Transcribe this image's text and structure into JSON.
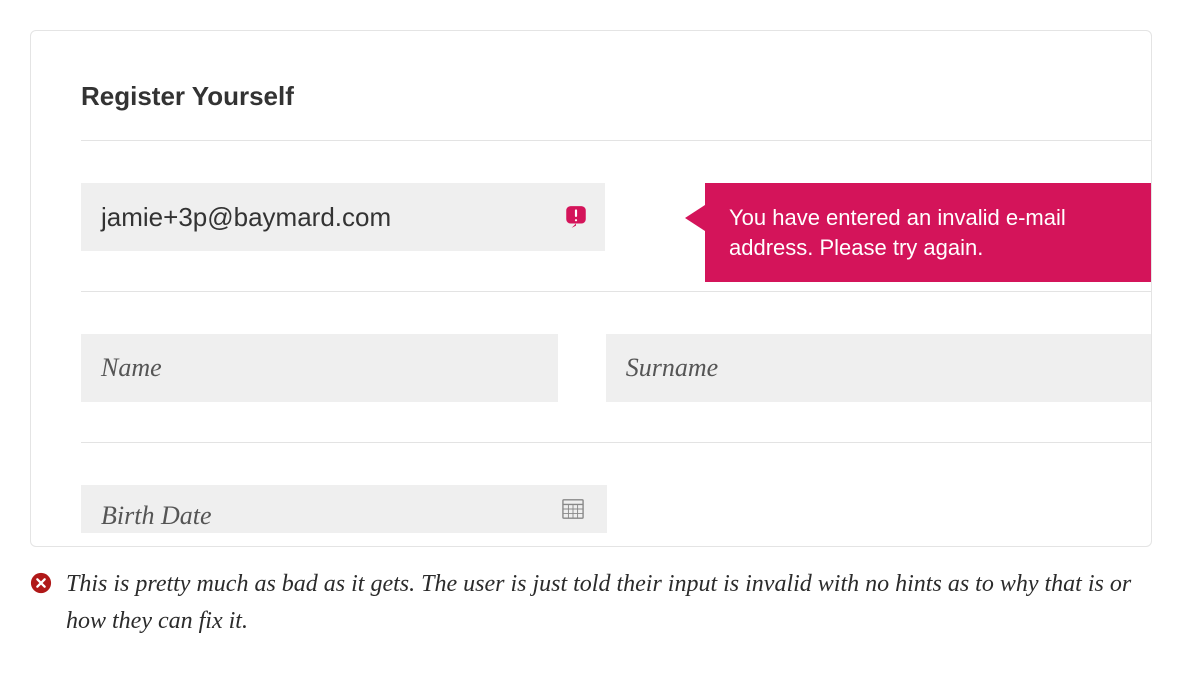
{
  "form": {
    "title": "Register Yourself",
    "email_value": "jamie+3p@baymard.com",
    "email_error": "You have entered an invalid e-mail address. Please try again.",
    "name_placeholder": "Name",
    "surname_placeholder": "Surname",
    "birth_placeholder": "Birth Date"
  },
  "caption": "This is pretty much as bad as it gets. The user is just told their input is invalid with no hints as to why that is or how they can fix it."
}
